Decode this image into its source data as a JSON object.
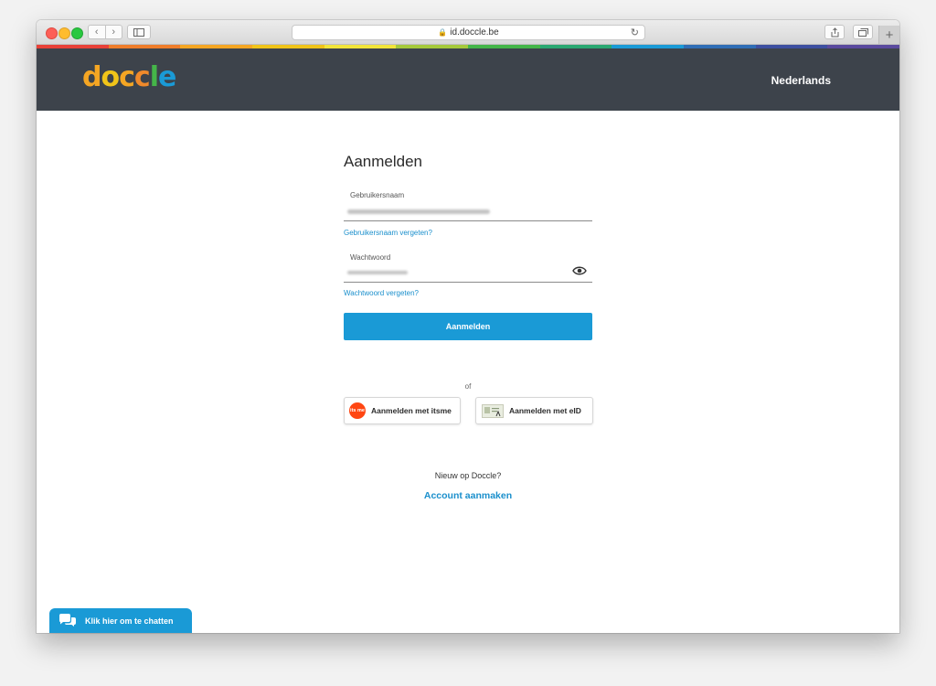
{
  "browser": {
    "url": "id.doccle.be",
    "nav_back": "‹",
    "nav_forward": "›",
    "new_tab": "+"
  },
  "header": {
    "logo_text": [
      "d",
      "o",
      "c",
      "c",
      "l",
      "e"
    ],
    "logo_colors": [
      "#f5a623",
      "#f0c419",
      "#f5a623",
      "#f08a2b",
      "#45b649",
      "#1a9ad6"
    ],
    "language": "Nederlands"
  },
  "rainbow_colors": [
    "#e84138",
    "#ef7d2a",
    "#f5a623",
    "#f0c419",
    "#f2e53a",
    "#a5c93b",
    "#45b649",
    "#2aa872",
    "#1a9ad6",
    "#2f6db5",
    "#3d4fa0",
    "#5a4a9e"
  ],
  "form": {
    "title": "Aanmelden",
    "username_label": "Gebruikersnaam",
    "forgot_username": "Gebruikersnaam vergeten?",
    "password_label": "Wachtwoord",
    "forgot_password": "Wachtwoord vergeten?",
    "submit": "Aanmelden",
    "or": "of",
    "itsme_logo": "its me",
    "itsme_button": "Aanmelden met itsme",
    "eid_button": "Aanmelden met eID",
    "new_prompt": "Nieuw op Doccle?",
    "create_account": "Account aanmaken"
  },
  "chat": {
    "label": "Klik hier om te chatten"
  },
  "colors": {
    "header_bg": "#3d434b",
    "accent": "#1a9ad6",
    "itsme_orange": "#ff4612"
  }
}
